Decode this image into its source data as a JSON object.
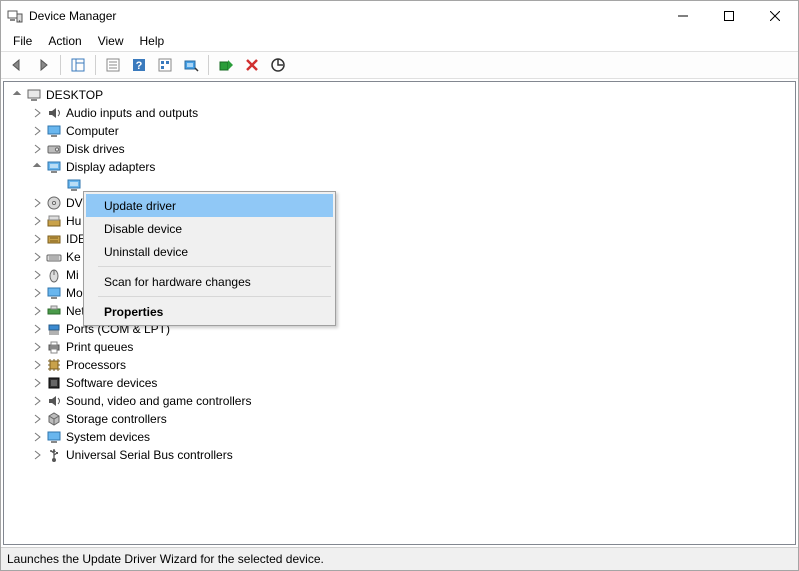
{
  "title": "Device Manager",
  "menus": {
    "file": "File",
    "action": "Action",
    "view": "View",
    "help": "Help"
  },
  "root": "DESKTOP",
  "nodes": [
    {
      "label": "Audio inputs and outputs",
      "exp": ">"
    },
    {
      "label": "Computer",
      "exp": ">"
    },
    {
      "label": "Disk drives",
      "exp": ">"
    },
    {
      "label": "Display adapters",
      "exp": "v"
    },
    {
      "label": "",
      "child": true
    },
    {
      "label": "DV",
      "exp": ">"
    },
    {
      "label": "Hu",
      "exp": ">"
    },
    {
      "label": "IDE",
      "exp": ">"
    },
    {
      "label": "Ke",
      "exp": ">"
    },
    {
      "label": "Mi",
      "exp": ">"
    },
    {
      "label": "Mo",
      "exp": ">"
    },
    {
      "label": "Network adapters",
      "exp": ">"
    },
    {
      "label": "Ports (COM & LPT)",
      "exp": ">"
    },
    {
      "label": "Print queues",
      "exp": ">"
    },
    {
      "label": "Processors",
      "exp": ">"
    },
    {
      "label": "Software devices",
      "exp": ">"
    },
    {
      "label": "Sound, video and game controllers",
      "exp": ">"
    },
    {
      "label": "Storage controllers",
      "exp": ">"
    },
    {
      "label": "System devices",
      "exp": ">"
    },
    {
      "label": "Universal Serial Bus controllers",
      "exp": ">"
    }
  ],
  "context": {
    "update": "Update driver",
    "disable": "Disable device",
    "uninstall": "Uninstall device",
    "scan": "Scan for hardware changes",
    "properties": "Properties"
  },
  "status": "Launches the Update Driver Wizard for the selected device."
}
